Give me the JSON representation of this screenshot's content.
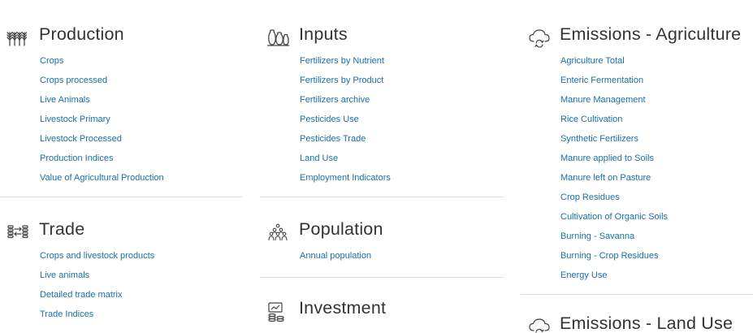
{
  "production": {
    "title": "Production",
    "icon": "wheat-icon",
    "links": [
      "Crops",
      "Crops processed",
      "Live Animals",
      "Livestock Primary",
      "Livestock Processed",
      "Production Indices",
      "Value of Agricultural Production"
    ]
  },
  "trade": {
    "title": "Trade",
    "icon": "trade-exchange-icon",
    "links": [
      "Crops and livestock products",
      "Live animals",
      "Detailed trade matrix",
      "Trade Indices"
    ]
  },
  "inputs": {
    "title": "Inputs",
    "icon": "sacks-icon",
    "links": [
      "Fertilizers by Nutrient",
      "Fertilizers by Product",
      "Fertilizers archive",
      "Pesticides Use",
      "Pesticides Trade",
      "Land Use",
      "Employment Indicators"
    ]
  },
  "population": {
    "title": "Population",
    "icon": "population-icon",
    "links": [
      "Annual population"
    ]
  },
  "investment": {
    "title": "Investment",
    "icon": "investment-icon"
  },
  "emissions_agriculture": {
    "title": "Emissions - Agriculture",
    "icon": "cloud-cycle-icon",
    "links": [
      "Agriculture Total",
      "Enteric Fermentation",
      "Manure Management",
      "Rice Cultivation",
      "Synthetic Fertilizers",
      "Manure applied to Soils",
      "Manure left on Pasture",
      "Crop Residues",
      "Cultivation of Organic Soils",
      "Burning - Savanna",
      "Burning - Crop Residues",
      "Energy Use"
    ]
  },
  "emissions_land_use": {
    "title": "Emissions - Land Use",
    "icon": "cloud-cycle-icon"
  },
  "colors": {
    "link": "#1a6fa8",
    "title": "#333333",
    "divider": "#dcdcdc"
  }
}
